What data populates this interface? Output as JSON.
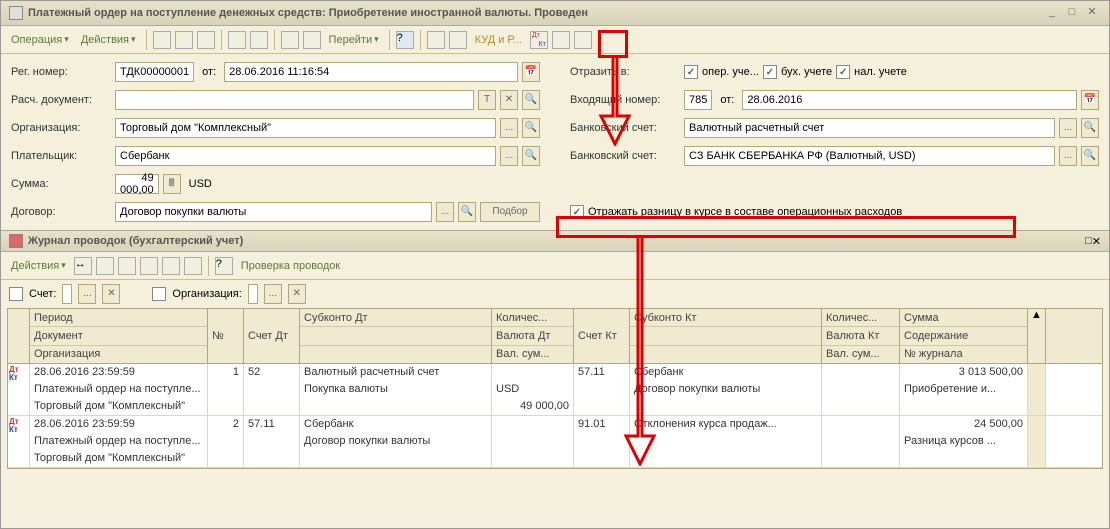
{
  "window": {
    "title": "Платежный ордер на поступление денежных средств: Приобретение иностранной валюты. Проведен"
  },
  "toolbar": {
    "operation": "Операция",
    "actions": "Действия",
    "goto": "Перейти",
    "kud": "КУД и Р..."
  },
  "form": {
    "reg_label": "Рег. номер:",
    "reg_value": "ТДК00000001",
    "from_label": "от:",
    "reg_date": "28.06.2016 11:16:54",
    "otrazit_label": "Отразить в:",
    "chk_oper": "опер. уче...",
    "chk_bukh": "бух. учете",
    "chk_nal": "нал. учете",
    "rasch_label": "Расч. документ:",
    "vkh_label": "Входящий номер:",
    "vkh_num": "785",
    "vkh_date": "28.06.2016",
    "org_label": "Организация:",
    "org_value": "Торговый дом \"Комплексный\"",
    "bank1_label": "Банковский счет:",
    "bank1_value": "Валютный расчетный счет",
    "payer_label": "Плательщик:",
    "payer_value": "Сбербанк",
    "bank2_label": "Банковский счет:",
    "bank2_value": "СЗ БАНК СБЕРБАНКА РФ (Валютный, USD)",
    "sum_label": "Сумма:",
    "sum_value": "49 000,00",
    "sum_cur": "USD",
    "dogovor_label": "Договор:",
    "dogovor_value": "Договор покупки валюты",
    "podbor": "Подбор",
    "reflect_diff": "Отражать разницу в курсе в составе операционных расходов"
  },
  "journal": {
    "title": "Журнал проводок (бухгалтерский учет)",
    "actions": "Действия",
    "check": "Проверка проводок",
    "filter_acct": "Счет:",
    "filter_org": "Организация:",
    "headers": {
      "period": "Период",
      "doc": "Документ",
      "org": "Организация",
      "num": "№",
      "acct_dt": "Счет Дт",
      "subk_dt": "Субконто Дт",
      "qty_dt": "Количес...",
      "val_dt": "Валюта Дт",
      "valsum_dt": "Вал. сум...",
      "acct_kt": "Счет Кт",
      "subk_kt": "Субконто Кт",
      "qty_kt": "Количес...",
      "val_kt": "Валюта Кт",
      "valsum_kt": "Вал. сум...",
      "sum": "Сумма",
      "content": "Содержание",
      "jnum": "№ журнала"
    },
    "rows": [
      {
        "period": "28.06.2016 23:59:59",
        "doc": "Платежный ордер на поступле...",
        "org": "Торговый дом \"Комплексный\"",
        "num": "1",
        "acct_dt": "52",
        "subk_dt1": "Валютный расчетный счет",
        "subk_dt2": "Покупка валюты",
        "val_dt": "USD",
        "valsum_dt": "49 000,00",
        "acct_kt": "57.11",
        "subk_kt1": "Сбербанк",
        "subk_kt2": "Договор покупки валюты",
        "sum": "3 013 500,00",
        "content": "Приобретение и..."
      },
      {
        "period": "28.06.2016 23:59:59",
        "doc": "Платежный ордер на поступле...",
        "org": "Торговый дом \"Комплексный\"",
        "num": "2",
        "acct_dt": "57.11",
        "subk_dt1": "Сбербанк",
        "subk_dt2": "Договор покупки валюты",
        "acct_kt": "91.01",
        "subk_kt1": "Отклонения курса продаж...",
        "sum": "24 500,00",
        "content": "Разница курсов ..."
      }
    ]
  }
}
